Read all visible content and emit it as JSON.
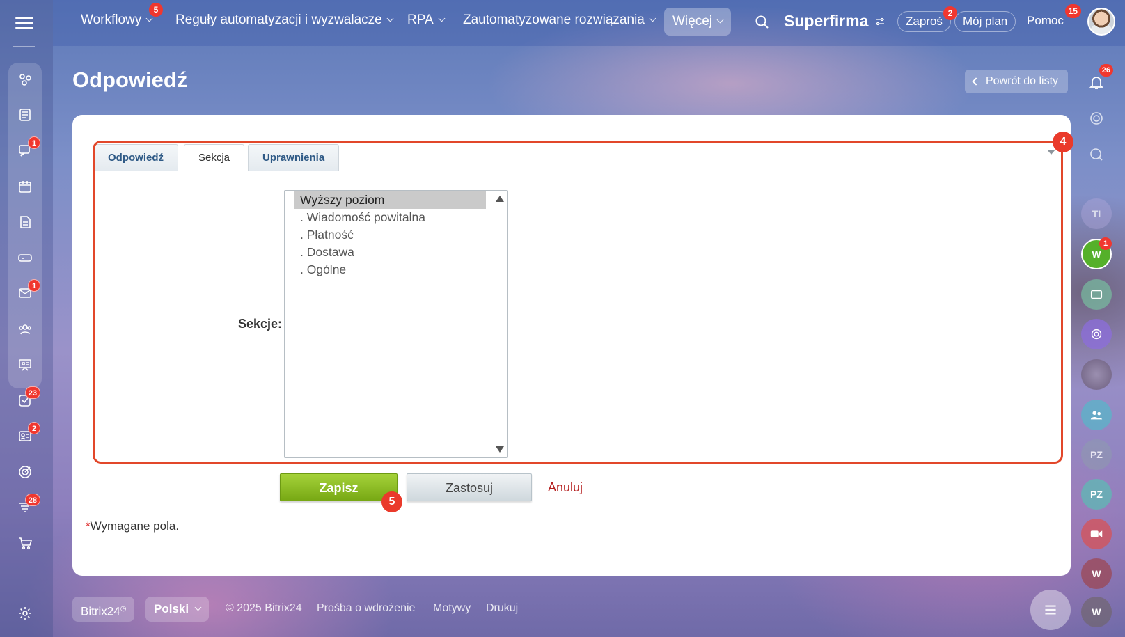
{
  "topnav": {
    "items": [
      {
        "label": "Workflowy",
        "badge": "5"
      },
      {
        "label": "Reguły automatyzacji i wyzwalacze"
      },
      {
        "label": "RPA"
      },
      {
        "label": "Zautomatyzowane rozwiązania"
      }
    ],
    "more_label": "Więcej",
    "brand": "Superfirma",
    "invite_label": "Zaproś",
    "invite_badge": "2",
    "plan_label": "Mój plan",
    "help_label": "Pomoc",
    "help_badge": "15"
  },
  "left_sidebar": {
    "badges": {
      "chat": "1",
      "mail": "1",
      "tasks": "23",
      "ads": "2",
      "funnel": "28"
    }
  },
  "right_sidebar": {
    "notifications_badge": "26",
    "avatar_ti": "TI",
    "avatar_w_green": "W",
    "avatar_w_green_badge": "1",
    "avatar_pz1": "PZ",
    "avatar_pz2": "PZ",
    "avatar_w_red": "W",
    "avatar_w_gray": "W"
  },
  "page": {
    "title": "Odpowiedź",
    "back_label": "Powrót do listy"
  },
  "form": {
    "tabs": [
      {
        "label": "Odpowiedź",
        "active": false
      },
      {
        "label": "Sekcja",
        "active": true
      },
      {
        "label": "Uprawnienia",
        "active": false
      }
    ],
    "sections_label": "Sekcje:",
    "sections_options": [
      {
        "label": "Wyższy poziom",
        "selected": true
      },
      {
        "label": ". Wiadomość powitalna"
      },
      {
        "label": ". Płatność"
      },
      {
        "label": ". Dostawa"
      },
      {
        "label": ". Ogólne"
      }
    ],
    "save_label": "Zapisz",
    "apply_label": "Zastosuj",
    "cancel_label": "Anuluj",
    "required_asterisk": "*",
    "required_note": "Wymagane pola."
  },
  "annotations": {
    "step_4": "4",
    "step_5": "5",
    "highlight_color": "#e2472a"
  },
  "footer": {
    "brand": "Bitrix24",
    "language": "Polski",
    "copyright": "© 2025 Bitrix24",
    "links": [
      "Prośba o wdrożenie",
      "Motywy",
      "Drukuj"
    ]
  }
}
